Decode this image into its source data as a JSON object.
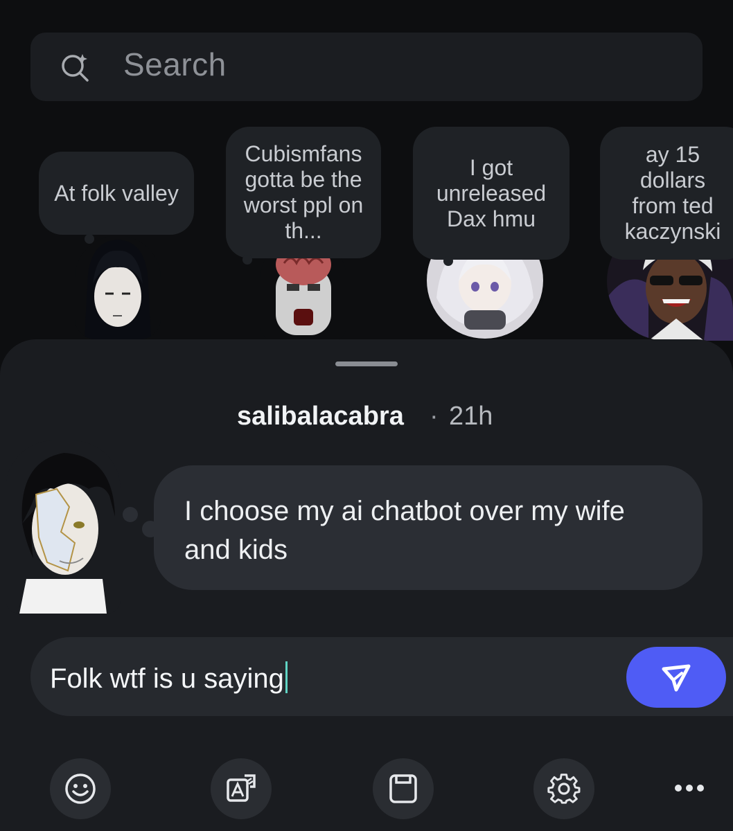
{
  "search": {
    "placeholder": "Search",
    "icon": "search-sparkle-icon"
  },
  "notes": [
    {
      "text": "At folk valley"
    },
    {
      "text": "Cubismfans gotta be the worst ppl on th..."
    },
    {
      "text": "I got unreleased Dax hmu"
    },
    {
      "text": "ay 15 dollars from ted kaczynski"
    }
  ],
  "note_sheet": {
    "username": "salibalacabra",
    "separator": "·",
    "time": "21h",
    "message": "I choose my ai chatbot over my wife and kids"
  },
  "reply": {
    "value": "Folk wtf is u saying",
    "send_icon": "send-icon"
  },
  "toolbar": {
    "icons": [
      "emoji-icon",
      "translate-icon",
      "save-icon",
      "settings-icon",
      "more-icon"
    ]
  },
  "colors": {
    "accent": "#4f5cf5",
    "caret": "#5fd4c4"
  }
}
